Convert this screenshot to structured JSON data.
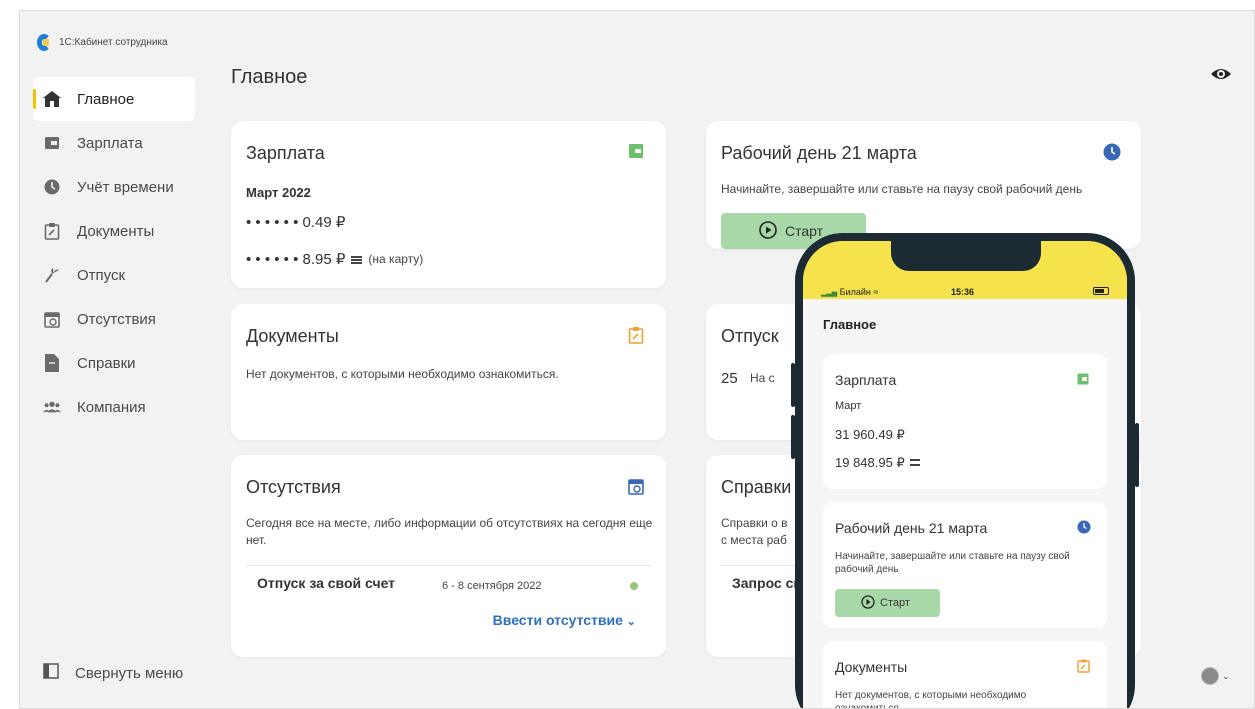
{
  "app": {
    "title": "1С:Кабинет сотрудника"
  },
  "page_title": "Главное",
  "sidebar": {
    "items": [
      {
        "label": "Главное",
        "icon": "home-icon",
        "active": true
      },
      {
        "label": "Зарплата",
        "icon": "wallet-icon"
      },
      {
        "label": "Учёт времени",
        "icon": "clock-icon"
      },
      {
        "label": "Документы",
        "icon": "clipboard-icon"
      },
      {
        "label": "Отпуск",
        "icon": "palm-icon"
      },
      {
        "label": "Отсутствия",
        "icon": "calendar-clock-icon"
      },
      {
        "label": "Справки",
        "icon": "certificate-icon"
      },
      {
        "label": "Компания",
        "icon": "people-icon"
      }
    ],
    "collapse_label": "Свернуть меню"
  },
  "cards": {
    "salary": {
      "title": "Зарплата",
      "period": "Март 2022",
      "amount1": "• • •  • • • 0.49 ₽",
      "amount2": "• • •  • • • 8.95 ₽",
      "amount2_note": "(на карту)"
    },
    "workday": {
      "title": "Рабочий день 21 марта",
      "text": "Начинайте, завершайте или ставьте на паузу свой рабочий день",
      "start_label": "Старт"
    },
    "documents": {
      "title": "Документы",
      "text": "Нет документов, с которыми необходимо ознакомиться."
    },
    "vacation": {
      "title": "Отпуск",
      "days": "25",
      "text": "На с"
    },
    "absences": {
      "title": "Отсутствия",
      "text": "Сегодня все на месте, либо информации об отсутствиях на сегодня еще нет.",
      "row_label": "Отпуск за свой счет",
      "row_dates": "6 - 8 сентября 2022",
      "link": "Ввести отсутствие"
    },
    "certificates": {
      "title": "Справки",
      "text1": "Справки о в",
      "text2": "с места раб",
      "row_label": "Запрос сп"
    }
  },
  "phone": {
    "carrier": "Билайн",
    "time": "15:36",
    "title": "Главное",
    "salary": {
      "title": "Зарплата",
      "period": "Март",
      "amount1": "31 960.49 ₽",
      "amount2": "19 848.95 ₽"
    },
    "workday": {
      "title": "Рабочий день 21 марта",
      "text": "Начинайте, завершайте или ставьте на паузу свой рабочий день",
      "start_label": "Старт"
    },
    "documents": {
      "title": "Документы",
      "text": "Нет документов, с которыми необходимо ознакомиться."
    }
  },
  "colors": {
    "accent_yellow": "#f5c400",
    "green_icon": "#6cc06c",
    "blue_icon": "#3a67b7",
    "orange_icon": "#f0a030",
    "link_blue": "#2f6fbf",
    "start_green": "#a8d8a8"
  }
}
